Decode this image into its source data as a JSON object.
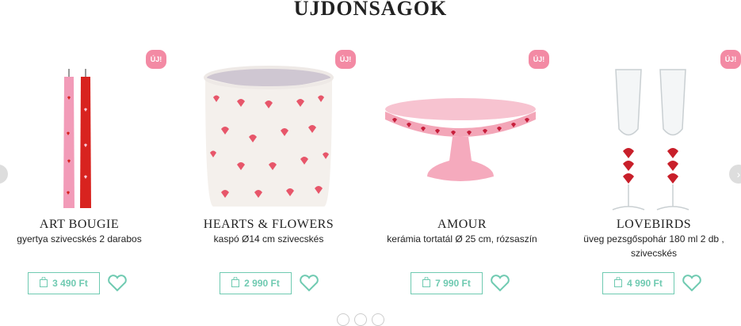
{
  "section": {
    "title": "ÚJDONSÁGOK"
  },
  "colors": {
    "accent": "#6fcab1",
    "badge": "#f38aa4"
  },
  "products": [
    {
      "badge": "ÚJ!",
      "name": "ART BOUGIE",
      "desc": "gyertya szivecskés 2 darabos",
      "price": "3 490 Ft",
      "image": "pink-red-candles"
    },
    {
      "badge": "ÚJ!",
      "name": "HEARTS & FLOWERS",
      "desc": "kaspó Ø14 cm szivecskés",
      "price": "2 990 Ft",
      "image": "heart-planter"
    },
    {
      "badge": "ÚJ!",
      "name": "AMOUR",
      "desc": "kerámia tortatál Ø 25 cm, rózsaszín",
      "price": "7 990 Ft",
      "image": "pink-cake-stand"
    },
    {
      "badge": "ÚJ!",
      "name": "LOVEBIRDS",
      "desc": "üveg pezsgőspohár 180 ml 2 db , szivecskés",
      "price": "4 990 Ft",
      "image": "champagne-glasses"
    }
  ],
  "icons": {
    "cart": "shopping-bag-icon",
    "wishlist": "heart-outline-icon",
    "next": "chevron-right-icon",
    "prev": "chevron-left-icon"
  }
}
